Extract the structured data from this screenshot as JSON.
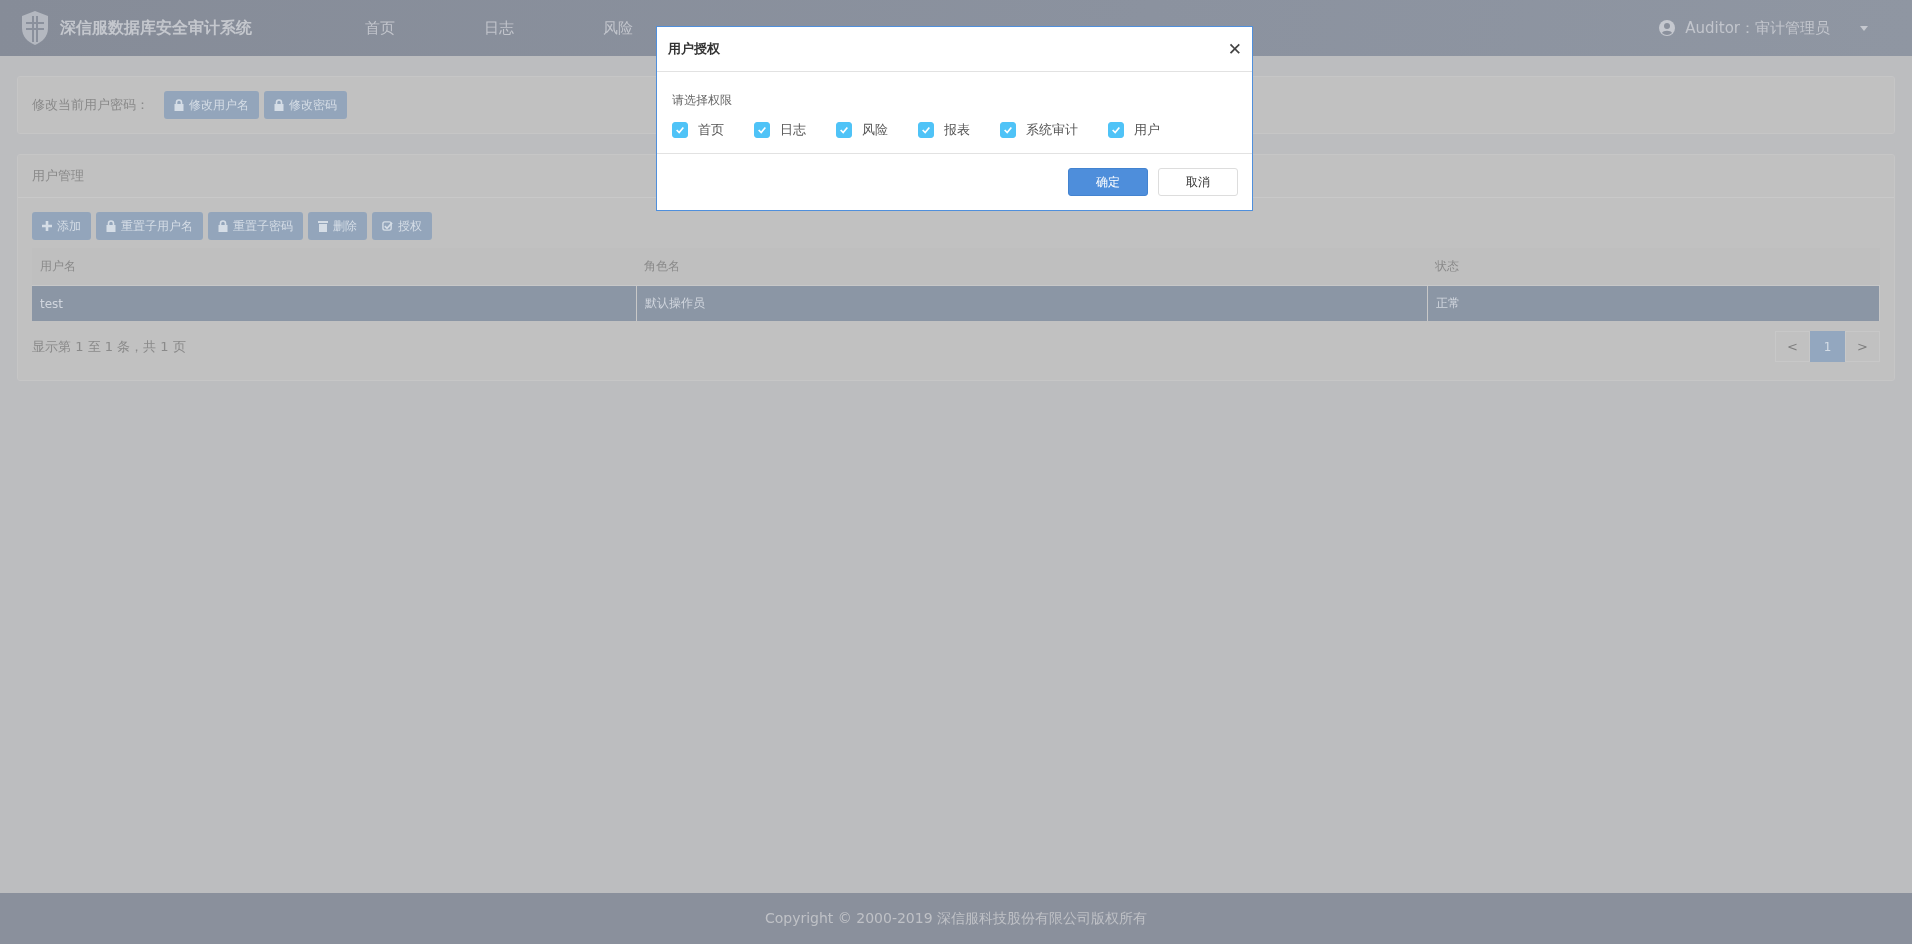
{
  "header": {
    "brand": "深信服数据库安全审计系统",
    "nav": [
      {
        "label": "首页",
        "selected": false
      },
      {
        "label": "日志",
        "selected": false
      },
      {
        "label": "风险",
        "selected": false
      }
    ],
    "user": "Auditor：审计管理员"
  },
  "account_panel": {
    "label": "修改当前用户密码：",
    "buttons": [
      "修改用户名",
      "修改密码"
    ]
  },
  "user_panel": {
    "title": "用户管理",
    "toolbar": [
      {
        "label": "添加",
        "kind": "plus"
      },
      {
        "label": "重置子用户名",
        "kind": "lock"
      },
      {
        "label": "重置子密码",
        "kind": "lock"
      },
      {
        "label": "删除",
        "kind": "trash"
      },
      {
        "label": "授权",
        "kind": "check"
      }
    ],
    "table": {
      "columns": [
        "用户名",
        "角色名",
        "状态"
      ],
      "rows": [
        {
          "cells": [
            "test",
            "默认操作员",
            "正常"
          ],
          "selected": true
        }
      ]
    },
    "summary": "显示第 1 至 1 条，共 1 页",
    "pagination": [
      {
        "label": "<",
        "kind": "prev",
        "selected": false
      },
      {
        "label": "1",
        "kind": "page",
        "selected": true
      },
      {
        "label": ">",
        "kind": "next",
        "selected": false
      }
    ]
  },
  "dialog": {
    "title": "用户授权",
    "close": "✕",
    "prompt": "请选择权限",
    "permissions": [
      {
        "label": "首页",
        "checked": true
      },
      {
        "label": "日志",
        "checked": true
      },
      {
        "label": "风险",
        "checked": true
      },
      {
        "label": "报表",
        "checked": true
      },
      {
        "label": "系统审计",
        "checked": true
      },
      {
        "label": "用户",
        "checked": true
      }
    ],
    "buttons": [
      {
        "label": "确定",
        "kind": "primary"
      },
      {
        "label": "取消",
        "kind": "default"
      }
    ]
  },
  "footer": "Copyright © 2000-2019 深信服科技股份有限公司版权所有"
}
